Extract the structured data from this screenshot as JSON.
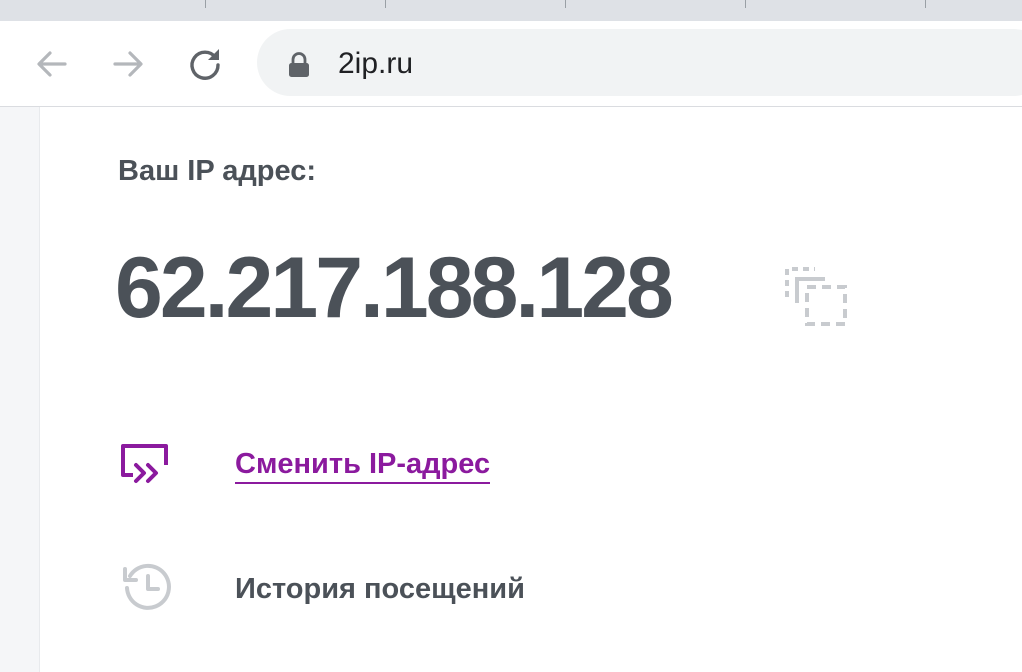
{
  "browser": {
    "url": "2ip.ru",
    "icons": {
      "back": "arrow-left-icon",
      "forward": "arrow-right-icon",
      "reload": "reload-icon",
      "secure": "lock-icon"
    }
  },
  "page": {
    "ip_label": "Ваш IP адрес:",
    "ip_address": "62.217.188.128",
    "actions": [
      {
        "label": "Сменить IP-адрес",
        "icon": "change-ip-icon",
        "color": "#8b1a9e"
      },
      {
        "label": "История посещений",
        "icon": "history-icon",
        "color": "#4b5158"
      }
    ]
  },
  "colors": {
    "text": "#4b5158",
    "accent": "#8b1a9e",
    "icon_gray": "#c8cbcf"
  }
}
